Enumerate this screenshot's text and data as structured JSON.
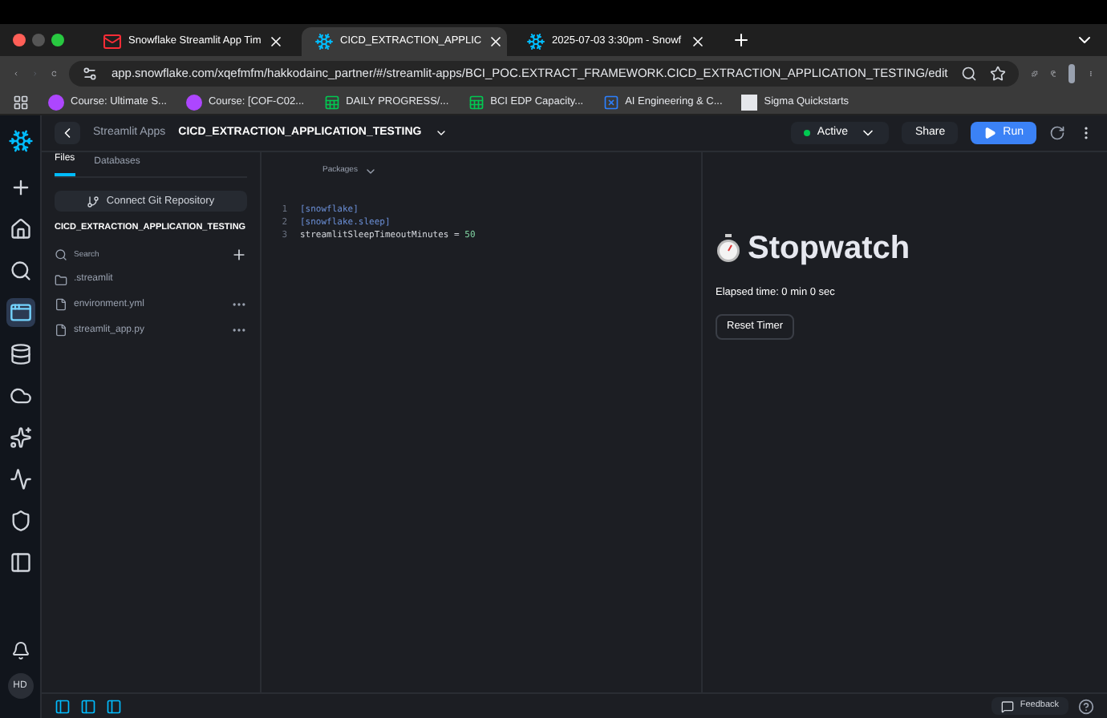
{
  "browser": {
    "tabs": [
      {
        "title": "Snowflake Streamlit App Tim",
        "selected": false,
        "kind": "mail"
      },
      {
        "title": "CICD_EXTRACTION_APPLIC",
        "selected": true,
        "kind": "snow"
      },
      {
        "title": "2025-07-03 3:30pm - Snowf",
        "selected": false,
        "kind": "snow"
      }
    ],
    "url": "app.snowflake.com/xqefmfm/hakkodainc_partner/#/streamlit-apps/BCI_POC.EXTRACT_FRAMEWORK.CICD_EXTRACTION_APPLICATION_TESTING/edit",
    "bookmarks": [
      {
        "label": "Course: Ultimate S...",
        "kind": "course"
      },
      {
        "label": "Course: [COF-C02...",
        "kind": "course"
      },
      {
        "label": "DAILY PROGRESS/...",
        "kind": "sheet"
      },
      {
        "label": "BCI EDP Capacity...",
        "kind": "sheet"
      },
      {
        "label": "AI Engineering & C...",
        "kind": "board"
      },
      {
        "label": "Sigma Quickstarts",
        "kind": "sigma"
      }
    ]
  },
  "nav": {
    "items": [
      {
        "kind": "plus",
        "selected": false
      },
      {
        "kind": "home",
        "selected": false
      },
      {
        "kind": "search",
        "selected": false
      },
      {
        "kind": "app",
        "selected": true
      },
      {
        "kind": "database",
        "selected": false
      },
      {
        "kind": "cloud",
        "selected": false
      },
      {
        "kind": "sparkle",
        "selected": false
      },
      {
        "kind": "activity",
        "selected": false
      },
      {
        "kind": "shield",
        "selected": false
      },
      {
        "kind": "panel",
        "selected": false
      }
    ],
    "avatar": "HD"
  },
  "header": {
    "breadcrumb": "Streamlit Apps",
    "app_name": "CICD_EXTRACTION_APPLICATION_TESTING",
    "status": "Active",
    "share": "Share",
    "run": "Run"
  },
  "files_panel": {
    "tabs": [
      {
        "label": "Files",
        "selected": true
      },
      {
        "label": "Databases",
        "selected": false
      }
    ],
    "connect": "Connect Git Repository",
    "title": "CICD_EXTRACTION_APPLICATION_TESTING",
    "search": {
      "placeholder": "Search"
    },
    "items": [
      {
        "name": ".streamlit",
        "kind": "folder"
      },
      {
        "name": "environment.yml",
        "kind": "file"
      },
      {
        "name": "streamlit_app.py",
        "kind": "file"
      }
    ]
  },
  "editor": {
    "packages": "Packages",
    "lines": [
      {
        "number": "1",
        "tokens": [
          {
            "text": "[snowflake]",
            "kind": "section"
          }
        ]
      },
      {
        "number": "2",
        "tokens": [
          {
            "text": "[snowflake.sleep]",
            "kind": "section"
          }
        ]
      },
      {
        "number": "3",
        "tokens": [
          {
            "text": "streamlitSleepTimeoutMinutes = ",
            "kind": "plain"
          },
          {
            "text": "50",
            "kind": "number"
          }
        ]
      }
    ]
  },
  "preview": {
    "title": "Stopwatch",
    "elapsed": "Elapsed time: 0 min 0 sec",
    "button": "Reset Timer"
  },
  "footer": {
    "feedback": "Feedback"
  }
}
